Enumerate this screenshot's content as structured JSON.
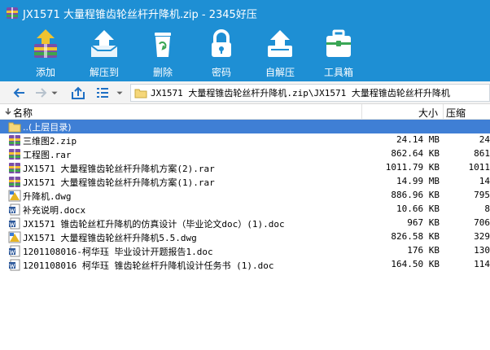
{
  "window": {
    "title": "JX1571 大量程锥齿轮丝杆升降机.zip - 2345好压"
  },
  "toolbar": {
    "items": [
      {
        "label": "添加",
        "icon": "add-archive-icon"
      },
      {
        "label": "解压到",
        "icon": "extract-icon"
      },
      {
        "label": "删除",
        "icon": "delete-icon"
      },
      {
        "label": "密码",
        "icon": "password-lock-icon"
      },
      {
        "label": "自解压",
        "icon": "self-extract-icon"
      },
      {
        "label": "工具箱",
        "icon": "toolbox-icon"
      }
    ]
  },
  "address": {
    "path": "JX1571 大量程锥齿轮丝杆升降机.zip\\JX1571 大量程锥齿轮丝杆升降机"
  },
  "columns": {
    "name": "名称",
    "size": "大小",
    "packed": "压缩"
  },
  "files": [
    {
      "name": "..(上层目录)",
      "size": "",
      "packed": "",
      "type": "folder",
      "selected": true
    },
    {
      "name": "三维图2.zip",
      "size": "24.14 MB",
      "packed": "24",
      "type": "archive"
    },
    {
      "name": "工程图.rar",
      "size": "862.64 KB",
      "packed": "861",
      "type": "archive"
    },
    {
      "name": "JX1571 大量程锥齿轮丝杆升降机方案(2).rar",
      "size": "1011.79 KB",
      "packed": "1011",
      "type": "archive"
    },
    {
      "name": "JX1571 大量程锥齿轮丝杆升降机方案(1).rar",
      "size": "14.99 MB",
      "packed": "14",
      "type": "archive"
    },
    {
      "name": "升降机.dwg",
      "size": "886.96 KB",
      "packed": "795",
      "type": "dwg"
    },
    {
      "name": "补充说明.docx",
      "size": "10.66 KB",
      "packed": "8",
      "type": "doc"
    },
    {
      "name": "JX1571 锥齿轮丝杠升降机的仿真设计（毕业论文doc）(1).doc",
      "size": "967 KB",
      "packed": "706",
      "type": "doc"
    },
    {
      "name": "JX1571 大量程锥齿轮丝杆升降机5.5.dwg",
      "size": "826.58 KB",
      "packed": "329",
      "type": "dwg"
    },
    {
      "name": "1201108016-柯华珏 毕业设计开题报告1.doc",
      "size": "176 KB",
      "packed": "130",
      "type": "doc"
    },
    {
      "name": "1201108016 柯华珏 锥齿轮丝杆升降机设计任务书 (1).doc",
      "size": "164.50 KB",
      "packed": "114",
      "type": "doc"
    }
  ],
  "colors": {
    "titlebar": "#1e8fd4",
    "selection": "#3f7fd5"
  }
}
